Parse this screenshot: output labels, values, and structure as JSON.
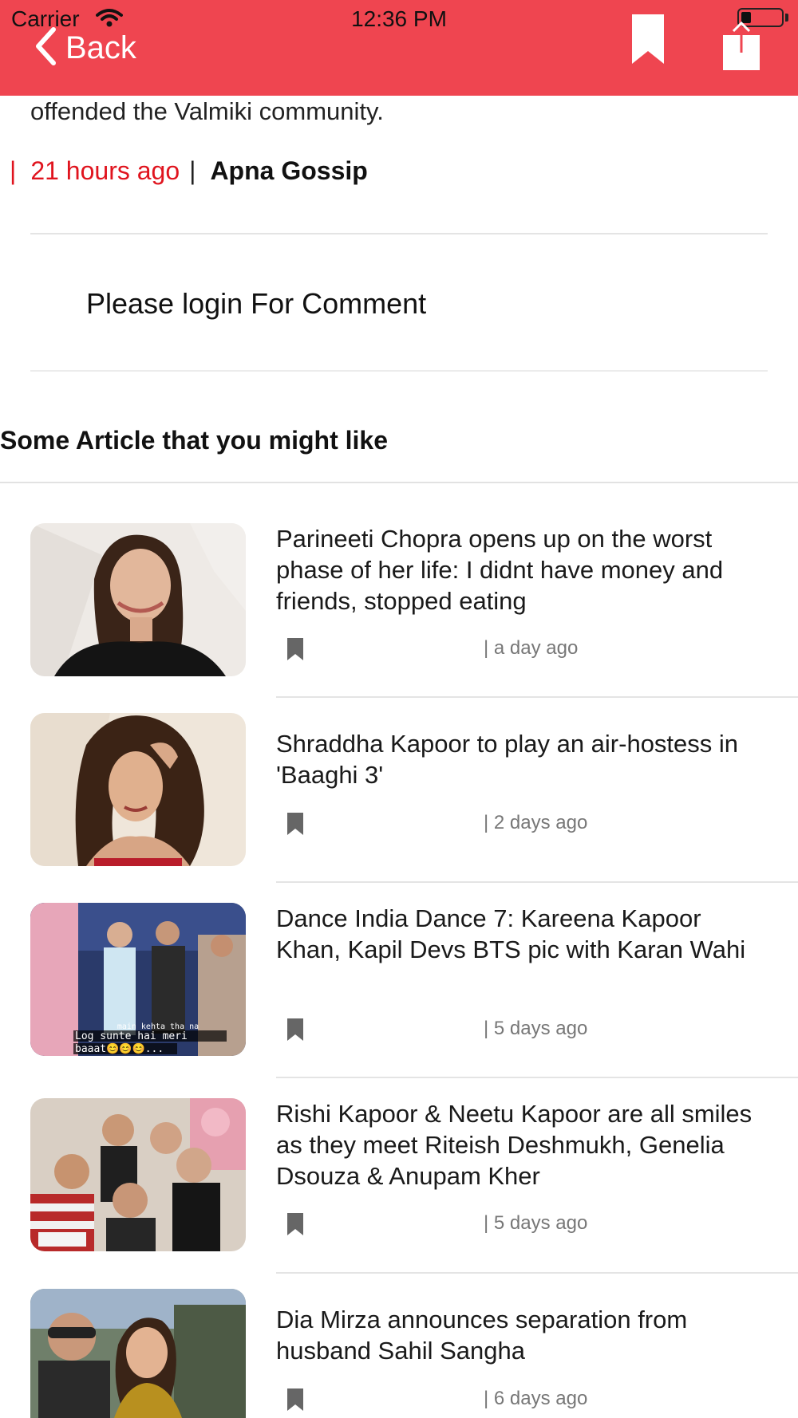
{
  "status_bar": {
    "carrier": "Carrier",
    "time": "12:36 PM"
  },
  "nav": {
    "back_label": "Back",
    "bar_color": "#ef4550"
  },
  "article": {
    "text_tail": "offended the Valmiki community.",
    "separator": "|",
    "time": "21 hours ago",
    "separator2": "|",
    "source": "Apna Gossip"
  },
  "comment": {
    "login_text": "Please login For Comment"
  },
  "related": {
    "heading": "Some Article that you might like",
    "items": [
      {
        "title": "Parineeti Chopra opens up on the worst phase of her life: I didnt have money and friends, stopped eating",
        "time": "| a day ago"
      },
      {
        "title": "Shraddha Kapoor to play an air-hostess in 'Baaghi 3'",
        "time": "| 2 days ago"
      },
      {
        "title": "Dance India Dance 7: Kareena Kapoor Khan, Kapil Devs BTS pic with Karan Wahi",
        "time": "| 5 days ago",
        "thumb_caption_1": "main kehta tha na",
        "thumb_caption_2": "Log sunte hai meri",
        "thumb_caption_3": "baaat😊😊😊..."
      },
      {
        "title": "Rishi Kapoor & Neetu Kapoor are all smiles as they meet Riteish Deshmukh, Genelia Dsouza & Anupam Kher",
        "time": "| 5 days ago"
      },
      {
        "title": "Dia Mirza announces separation from husband Sahil Sangha",
        "time": "| 6 days ago"
      }
    ]
  },
  "icons": {
    "back": "chevron-left-icon",
    "bookmark": "bookmark-icon",
    "share": "share-icon",
    "wifi": "wifi-icon",
    "battery": "battery-icon"
  },
  "colors": {
    "accent_red": "#e0141e",
    "text_grey": "#777777"
  }
}
